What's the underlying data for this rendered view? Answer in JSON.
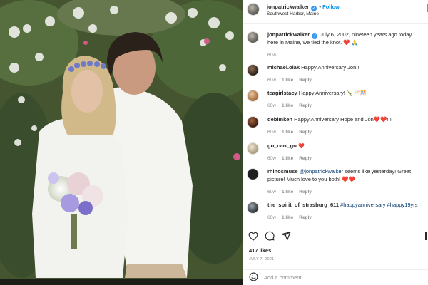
{
  "post": {
    "username": "jonpatrickwalker",
    "follow_label": "Follow",
    "separator": "•",
    "location": "Southwest Harbor, Maine",
    "caption_user": "jonpatrickwalker",
    "caption_text": "July 6, 2002, nineteen years ago today, here in Maine, we tied the knot. ❤️ 🙏",
    "caption_time": "60w",
    "likes": "417 likes",
    "date": "JULY 7, 2021",
    "add_comment_placeholder": "Add a comment..."
  },
  "comments": [
    {
      "user": "michael.olak",
      "text": "Happy Anniversary Jon!!!",
      "time": "60w",
      "likes": "1 like",
      "reply": "Reply"
    },
    {
      "user": "teagirlstacy",
      "text": "Happy Anniversary! 🍾🥂🎊",
      "time": "60w",
      "likes": "1 like",
      "reply": "Reply"
    },
    {
      "user": "debimken",
      "text": "Happy Anniversary Hope and Jon❤️❤️!!!",
      "time": "60w",
      "likes": "1 like",
      "reply": "Reply"
    },
    {
      "user": "go_carr_go",
      "text": "❤️",
      "time": "60w",
      "likes": "1 like",
      "reply": "Reply"
    },
    {
      "user": "rhinosmuse",
      "mention": "@jonpatrickwalker",
      "text": "seems like yesterday! Great picture! Much love to you both! ❤️❤️",
      "time": "60w",
      "likes": "1 like",
      "reply": "Reply"
    },
    {
      "user": "the_spirit_of_strasburg_611",
      "tags": "#happyanniversary #happy19yrs",
      "time": "60w",
      "likes": "1 like",
      "reply": "Reply"
    }
  ],
  "icons": {
    "like": "heart-icon",
    "comment": "comment-icon",
    "share": "share-icon",
    "emoji": "emoji-icon"
  },
  "colors": {
    "link": "#00376b",
    "follow": "#0095f6",
    "verified": "#3897f0",
    "heart": "#ed1c3a"
  }
}
